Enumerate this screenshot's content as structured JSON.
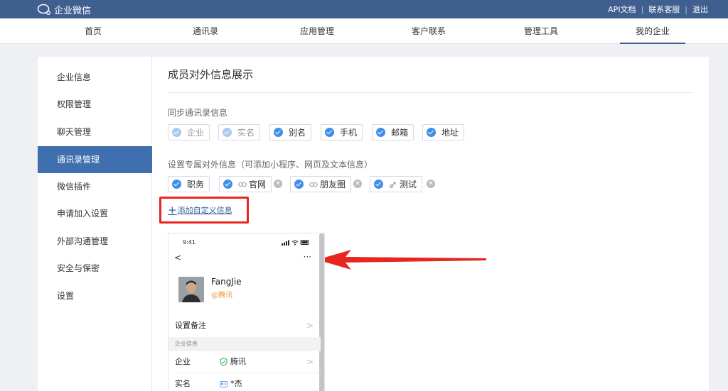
{
  "topbar": {
    "logo_text": "企业微信",
    "links": [
      "API文档",
      "联系客服",
      "退出"
    ]
  },
  "nav": {
    "items": [
      "首页",
      "通讯录",
      "应用管理",
      "客户联系",
      "管理工具",
      "我的企业"
    ],
    "active": "我的企业"
  },
  "sidebar": {
    "items": [
      "企业信息",
      "权限管理",
      "聊天管理",
      "通讯录管理",
      "微信插件",
      "申请加入设置",
      "外部沟通管理",
      "安全与保密",
      "设置"
    ],
    "active": "通讯录管理"
  },
  "main": {
    "title": "成员对外信息展示",
    "sync_label": "同步通讯录信息",
    "sync_tags": [
      {
        "label": "企业",
        "checked": true,
        "disabled": true
      },
      {
        "label": "实名",
        "checked": true,
        "disabled": true
      },
      {
        "label": "别名",
        "checked": true,
        "disabled": false
      },
      {
        "label": "手机",
        "checked": true,
        "disabled": false
      },
      {
        "label": "邮箱",
        "checked": true,
        "disabled": false
      },
      {
        "label": "地址",
        "checked": true,
        "disabled": false
      }
    ],
    "custom_label": "设置专属对外信息（可添加小程序、网页及文本信息）",
    "custom_tags": [
      {
        "label": "职务",
        "link_icon": false,
        "removable": false
      },
      {
        "label": "官网",
        "link_icon": true,
        "removable": true
      },
      {
        "label": "朋友圈",
        "link_icon": true,
        "removable": true
      },
      {
        "label": "测试",
        "link_icon": true,
        "removable": true
      }
    ],
    "add_custom": "添加自定义信息"
  },
  "preview": {
    "time": "9:41",
    "more": "···",
    "name": "FangJie",
    "org": "@腾讯",
    "remark_row": "设置备注",
    "section": "企业信息",
    "rows": [
      {
        "label": "企业",
        "value": "腾讯"
      },
      {
        "label": "实名",
        "value": "*杰"
      }
    ]
  },
  "colors": {
    "topbar": "#3f5f8f",
    "sidebar_active": "#3f6fae",
    "check": "#3f8ee8",
    "annotation": "#e8251e",
    "link": "#2f5f9e"
  }
}
